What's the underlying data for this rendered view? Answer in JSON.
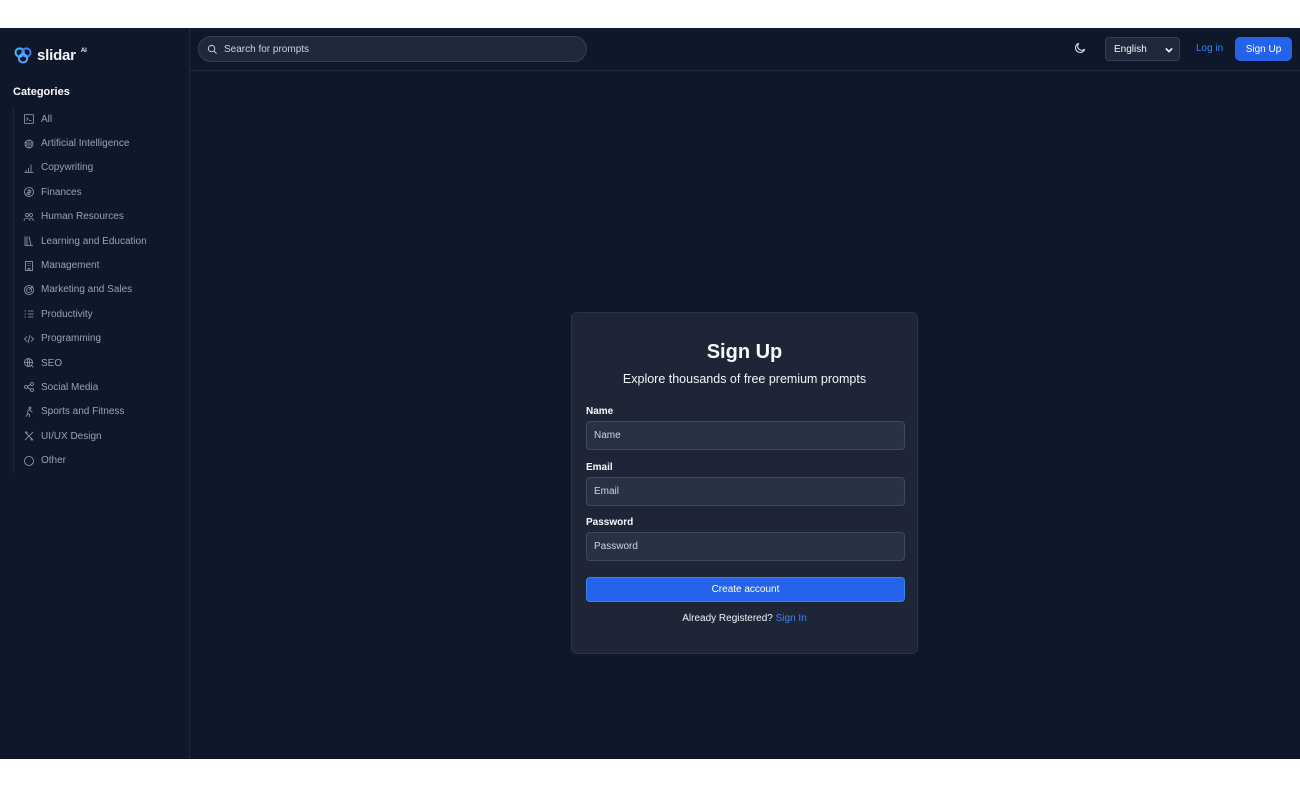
{
  "brand": {
    "name": "slidar",
    "suffix": "AI"
  },
  "sidebar": {
    "title": "Categories",
    "items": [
      {
        "label": "All",
        "icon": "terminal-icon"
      },
      {
        "label": "Artificial Intelligence",
        "icon": "brain-icon"
      },
      {
        "label": "Copywriting",
        "icon": "pen-chart-icon"
      },
      {
        "label": "Finances",
        "icon": "coin-icon"
      },
      {
        "label": "Human Resources",
        "icon": "people-icon"
      },
      {
        "label": "Learning and Education",
        "icon": "books-icon"
      },
      {
        "label": "Management",
        "icon": "building-icon"
      },
      {
        "label": "Marketing and Sales",
        "icon": "target-icon"
      },
      {
        "label": "Productivity",
        "icon": "list-check-icon"
      },
      {
        "label": "Programming",
        "icon": "code-icon"
      },
      {
        "label": "SEO",
        "icon": "globe-search-icon"
      },
      {
        "label": "Social Media",
        "icon": "share-icon"
      },
      {
        "label": "Sports and Fitness",
        "icon": "running-icon"
      },
      {
        "label": "UI/UX Design",
        "icon": "design-tools-icon"
      },
      {
        "label": "Other",
        "icon": "circle-icon"
      }
    ]
  },
  "header": {
    "search_placeholder": "Search for prompts",
    "language": "English",
    "login_label": "Log in",
    "signup_label": "Sign Up"
  },
  "form": {
    "title": "Sign Up",
    "subtitle": "Explore thousands of free premium prompts",
    "name_label": "Name",
    "name_placeholder": "Name",
    "email_label": "Email",
    "email_placeholder": "Email",
    "password_label": "Password",
    "password_placeholder": "Password",
    "submit_label": "Create account",
    "already_text": "Already Registered?",
    "signin_label": "Sign In"
  },
  "colors": {
    "background": "#0f172a",
    "card": "#1e2536",
    "accent": "#2563eb",
    "link": "#3b82f6"
  }
}
